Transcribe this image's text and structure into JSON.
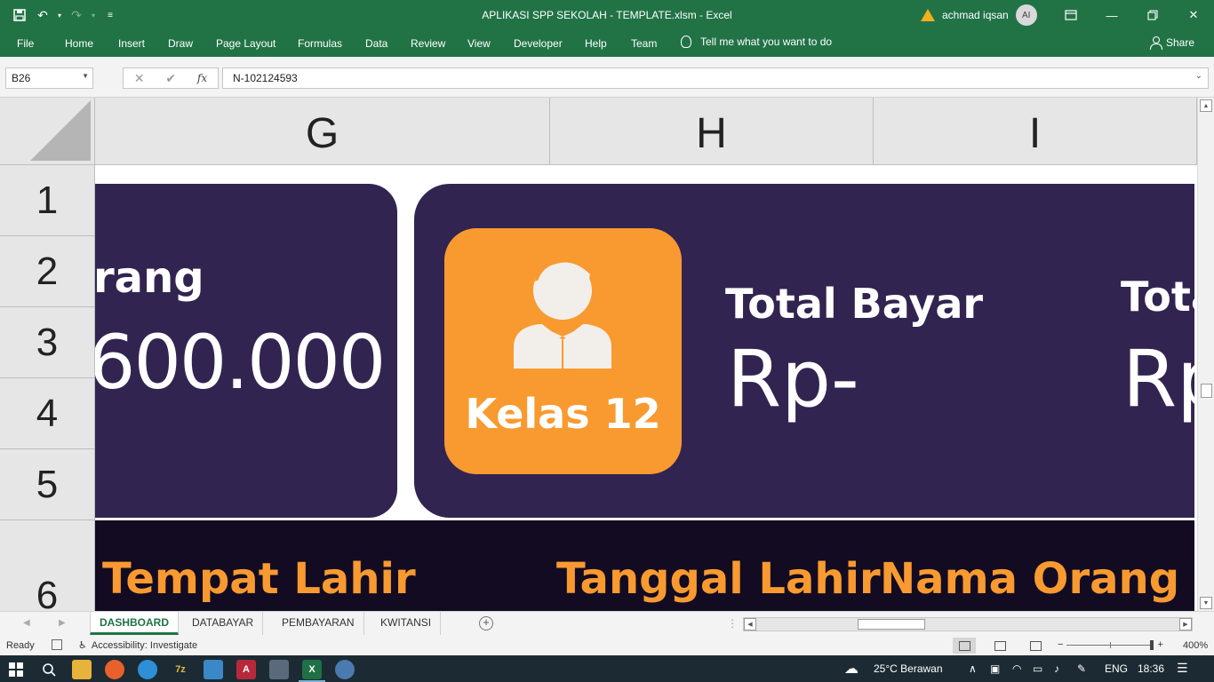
{
  "window": {
    "title": "APLIKASI SPP SEKOLAH - TEMPLATE.xlsm  -  Excel",
    "user_name": "achmad iqsan",
    "user_initials": "AI"
  },
  "ribbon": {
    "tabs": [
      "File",
      "Home",
      "Insert",
      "Draw",
      "Page Layout",
      "Formulas",
      "Data",
      "Review",
      "View",
      "Developer",
      "Help",
      "Team"
    ],
    "tell_me": "Tell me what you want to do",
    "share": "Share"
  },
  "formula_bar": {
    "name_box": "B26",
    "formula": "N-102124593"
  },
  "grid": {
    "columns": [
      "G",
      "H",
      "I"
    ],
    "rows": [
      "1",
      "2",
      "3",
      "4",
      "5",
      "6"
    ]
  },
  "dashboard": {
    "left_card_label": "rang",
    "left_card_amount": "600.000",
    "badge_label": "Kelas 12",
    "stat1_title": "Total Bayar",
    "stat1_value": "Rp-",
    "stat2_title": "Tota",
    "stat2_value": "Rp",
    "headers": [
      "Tempat Lahir",
      "Tanggal Lahir",
      "Nama Orang Tua"
    ]
  },
  "sheet_tabs": [
    "DASHBOARD",
    "DATABAYAR",
    "PEMBAYARAN",
    "KWITANSI"
  ],
  "status_bar": {
    "ready": "Ready",
    "accessibility": "Accessibility: Investigate",
    "zoom": "400%"
  },
  "taskbar": {
    "weather": "25°C  Berawan",
    "lang": "ENG",
    "time": "18:36"
  },
  "colors": {
    "excel_green": "#217346",
    "card_purple": "#322451",
    "band_dark": "#130b22",
    "orange": "#f89a30"
  }
}
